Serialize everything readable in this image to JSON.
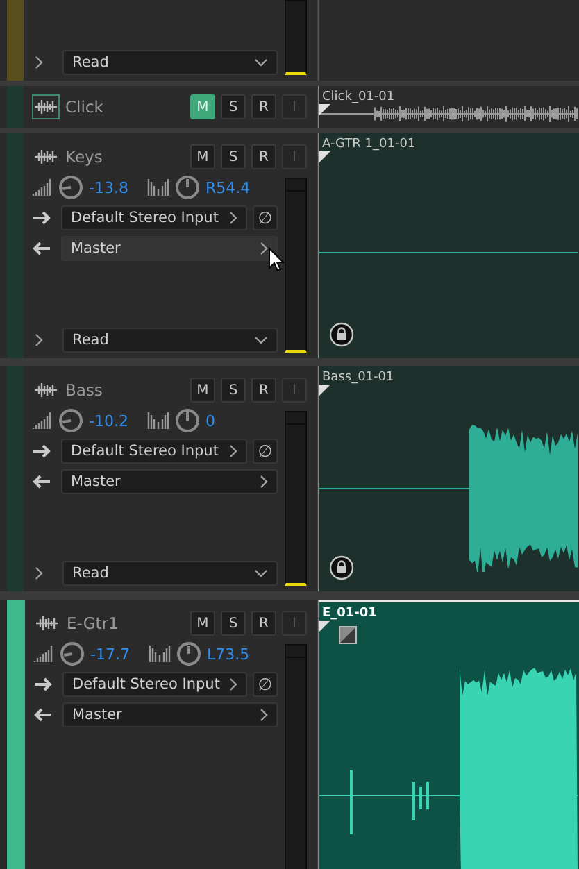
{
  "tracks": [
    {
      "kind": "partial",
      "color": "#5a4d1c",
      "selected": false,
      "automation": "Read",
      "clip": {
        "kind": "empty"
      }
    },
    {
      "kind": "compact",
      "name": "Click",
      "color": "#1d3a30",
      "selected": false,
      "icon_selected": true,
      "buttons": [
        {
          "label": "M",
          "on": true,
          "disabled": false
        },
        {
          "label": "S",
          "on": false,
          "disabled": false
        },
        {
          "label": "R",
          "on": false,
          "disabled": false
        },
        {
          "label": "I",
          "on": false,
          "disabled": true
        }
      ],
      "clip": {
        "kind": "dense",
        "name": "Click_01-01",
        "locked": false,
        "fade": false
      }
    },
    {
      "kind": "full",
      "name": "Keys",
      "color": "#1d3a30",
      "selected": false,
      "icon_selected": false,
      "buttons": [
        {
          "label": "M",
          "on": false,
          "disabled": false
        },
        {
          "label": "S",
          "on": false,
          "disabled": false
        },
        {
          "label": "R",
          "on": false,
          "disabled": false
        },
        {
          "label": "I",
          "on": false,
          "disabled": true
        }
      ],
      "volume": "-13.8",
      "pan": "R54.4",
      "input": "Default Stereo Input",
      "phase": "∅",
      "output": "Master",
      "output_hovered": true,
      "automation": "Read",
      "clip": {
        "kind": "flat",
        "name": "A-GTR 1_01-01",
        "locked": true,
        "fade": false
      }
    },
    {
      "kind": "full",
      "name": "Bass",
      "color": "#1d3a30",
      "selected": false,
      "icon_selected": false,
      "buttons": [
        {
          "label": "M",
          "on": false,
          "disabled": false
        },
        {
          "label": "S",
          "on": false,
          "disabled": false
        },
        {
          "label": "R",
          "on": false,
          "disabled": false
        },
        {
          "label": "I",
          "on": false,
          "disabled": true
        }
      ],
      "volume": "-10.2",
      "pan": "0",
      "input": "Default Stereo Input",
      "phase": "∅",
      "output": "Master",
      "output_hovered": false,
      "automation": "Read",
      "clip": {
        "kind": "burst",
        "name": "Bass_01-01",
        "locked": true,
        "fade": false
      }
    },
    {
      "kind": "full",
      "name": "E-Gtr1",
      "color": "#3dba8c",
      "selected": true,
      "icon_selected": false,
      "buttons": [
        {
          "label": "M",
          "on": false,
          "disabled": false
        },
        {
          "label": "S",
          "on": false,
          "disabled": false
        },
        {
          "label": "R",
          "on": false,
          "disabled": false
        },
        {
          "label": "I",
          "on": false,
          "disabled": true
        }
      ],
      "volume": "-17.7",
      "pan": "L73.5",
      "input": "Default Stereo Input",
      "phase": "∅",
      "output": "Master",
      "output_hovered": false,
      "clip": {
        "kind": "burst2",
        "name": "E_01-01",
        "locked": false,
        "fade": true
      }
    }
  ]
}
